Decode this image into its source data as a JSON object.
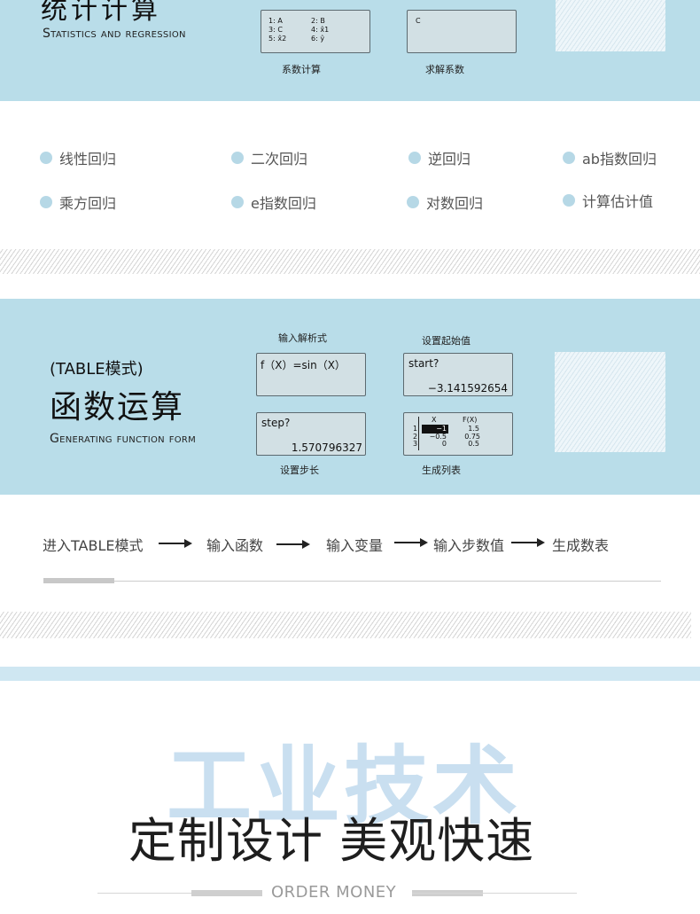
{
  "stats": {
    "title": "统计计算",
    "subtitle": "Statistics and regression",
    "screen1": {
      "lines": [
        "1: A",
        "2: B",
        "3: C",
        "4: x̂1",
        "5: x̂2",
        "6: ŷ"
      ],
      "caption": "系数计算"
    },
    "screen2": {
      "text": "C",
      "caption": "求解系数"
    }
  },
  "regressions": [
    "线性回归",
    "二次回归",
    "逆回归",
    "ab指数回归",
    "乘方回归",
    "e指数回归",
    "对数回归",
    "计算估计值"
  ],
  "table": {
    "mode_label": "(TABLE模式)",
    "title": "函数运算",
    "subtitle": "Generating function form",
    "screen_func": {
      "caption": "输入解析式",
      "text": "f（X）=sin（X）"
    },
    "screen_start": {
      "caption": "设置起始值",
      "prompt": "start?",
      "value": "−3.141592654"
    },
    "screen_step": {
      "caption": "设置步长",
      "prompt": "step?",
      "value": "1.570796327"
    },
    "screen_list": {
      "caption": "生成列表",
      "col_x": "X",
      "col_fx": "F(X)",
      "rows": [
        {
          "index": "1",
          "x": "−1",
          "fx": "1.5"
        },
        {
          "index": "2",
          "x": "−0.5",
          "fx": "0.75"
        },
        {
          "index": "3",
          "x": "0",
          "fx": "0.5"
        }
      ]
    }
  },
  "flow": [
    "进入TABLE模式",
    "输入函数",
    "输入变量",
    "输入步数值",
    "生成数表"
  ],
  "promo": {
    "watermark": "工业技术",
    "headline": "定制设计 美观快速",
    "tagline": "ORDER MONEY"
  },
  "colors": {
    "band": "#b9dde9",
    "dot": "#b6d8e6",
    "watermark": "#c9dff0"
  }
}
